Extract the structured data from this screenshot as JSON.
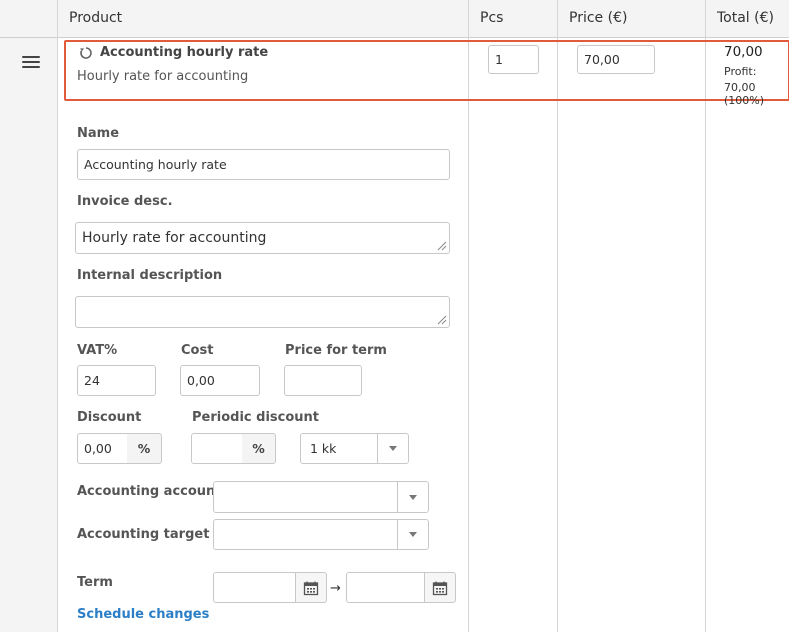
{
  "header": {
    "product": "Product",
    "pcs": "Pcs",
    "price": "Price (€)",
    "total": "Total (€)"
  },
  "row": {
    "title": "Accounting hourly rate",
    "subtitle": "Hourly rate for accounting",
    "pcs": "1",
    "price": "70,00",
    "total": "70,00",
    "profit_label": "Profit:",
    "profit_value": "70,00 (100%)"
  },
  "form": {
    "name_label": "Name",
    "name_value": "Accounting hourly rate",
    "invoice_label": "Invoice desc.",
    "invoice_value": "Hourly rate for accounting",
    "internal_label": "Internal description",
    "internal_value": "",
    "vat_label": "VAT%",
    "vat_value": "24",
    "cost_label": "Cost",
    "cost_value": "0,00",
    "term_price_label": "Price for term",
    "term_price_value": "",
    "discount_label": "Discount",
    "discount_value": "0,00",
    "percent": "%",
    "periodic_label": "Periodic discount",
    "periodic_value": "",
    "period_select": "1 kk",
    "acc_account_label": "Accounting account",
    "acc_account_value": "",
    "acc_target_label": "Accounting target",
    "acc_target_value": "",
    "term_label": "Term",
    "term_start": "",
    "term_end": "",
    "arrow": "→",
    "schedule_link": "Schedule changes"
  }
}
